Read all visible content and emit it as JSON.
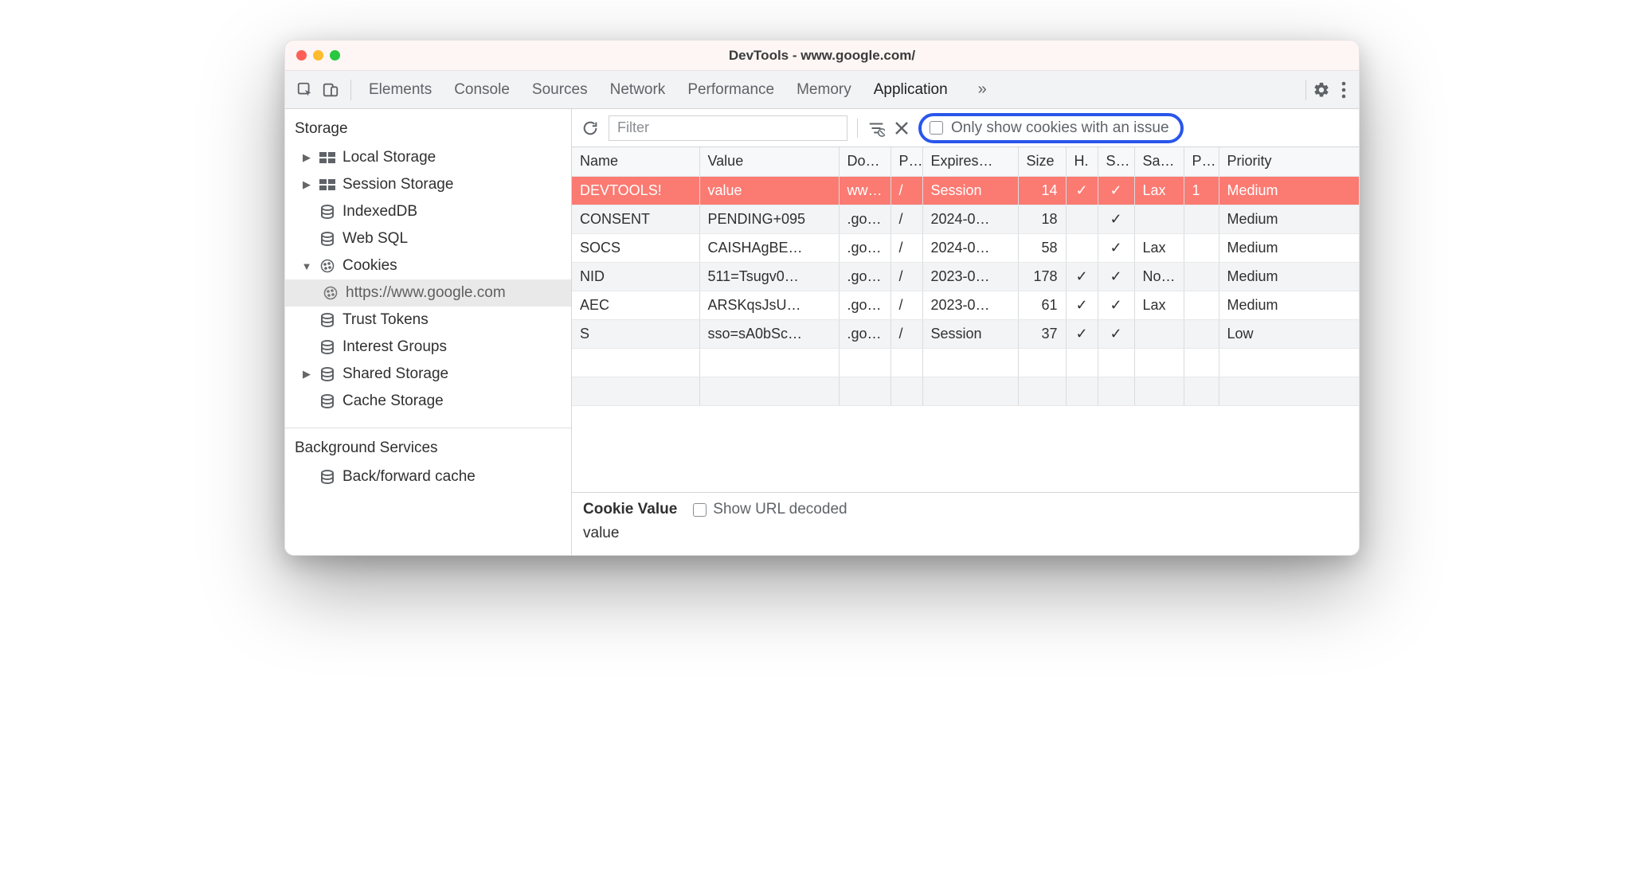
{
  "window": {
    "title": "DevTools - www.google.com/"
  },
  "tabs": {
    "items": [
      "Elements",
      "Console",
      "Sources",
      "Network",
      "Performance",
      "Memory",
      "Application"
    ],
    "active": "Application",
    "overflow": "»"
  },
  "sidebar": {
    "sections": {
      "storage": {
        "title": "Storage",
        "items": [
          {
            "label": "Local Storage",
            "icon": "grid",
            "expandable": true,
            "expanded": false
          },
          {
            "label": "Session Storage",
            "icon": "grid",
            "expandable": true,
            "expanded": false
          },
          {
            "label": "IndexedDB",
            "icon": "db",
            "expandable": false,
            "expanded": false
          },
          {
            "label": "Web SQL",
            "icon": "db",
            "expandable": false,
            "expanded": false
          },
          {
            "label": "Cookies",
            "icon": "cookie",
            "expandable": true,
            "expanded": true,
            "children": [
              {
                "label": "https://www.google.com",
                "icon": "cookie",
                "selected": true
              }
            ]
          },
          {
            "label": "Trust Tokens",
            "icon": "db",
            "expandable": false,
            "expanded": false
          },
          {
            "label": "Interest Groups",
            "icon": "db",
            "expandable": false,
            "expanded": false
          },
          {
            "label": "Shared Storage",
            "icon": "db",
            "expandable": true,
            "expanded": false
          },
          {
            "label": "Cache Storage",
            "icon": "db",
            "expandable": false,
            "expanded": false
          }
        ]
      },
      "background": {
        "title": "Background Services",
        "items": [
          {
            "label": "Back/forward cache",
            "icon": "db",
            "expandable": false,
            "expanded": false
          }
        ]
      }
    }
  },
  "toolbar": {
    "filter_placeholder": "Filter",
    "only_issues_label": "Only show cookies with an issue"
  },
  "columns": [
    "Name",
    "Value",
    "Do…",
    "P…",
    "Expires…",
    "Size",
    "H.",
    "S…",
    "Sa…",
    "P…",
    "Priority"
  ],
  "rows": [
    {
      "issue": true,
      "name": "DEVTOOLS!",
      "value": "value",
      "domain": "ww…",
      "path": "/",
      "expires": "Session",
      "size": "14",
      "http": "✓",
      "secure": "✓",
      "samesite": "Lax",
      "partition": "1",
      "priority": "Medium"
    },
    {
      "issue": false,
      "name": "CONSENT",
      "value": "PENDING+095",
      "domain": ".go…",
      "path": "/",
      "expires": "2024-0…",
      "size": "18",
      "http": "",
      "secure": "✓",
      "samesite": "",
      "partition": "",
      "priority": "Medium"
    },
    {
      "issue": false,
      "name": "SOCS",
      "value": "CAISHAgBE…",
      "domain": ".go…",
      "path": "/",
      "expires": "2024-0…",
      "size": "58",
      "http": "",
      "secure": "✓",
      "samesite": "Lax",
      "partition": "",
      "priority": "Medium"
    },
    {
      "issue": false,
      "name": "NID",
      "value": "511=Tsugv0…",
      "domain": ".go…",
      "path": "/",
      "expires": "2023-0…",
      "size": "178",
      "http": "✓",
      "secure": "✓",
      "samesite": "No…",
      "partition": "",
      "priority": "Medium"
    },
    {
      "issue": false,
      "name": "AEC",
      "value": "ARSKqsJsU…",
      "domain": ".go…",
      "path": "/",
      "expires": "2023-0…",
      "size": "61",
      "http": "✓",
      "secure": "✓",
      "samesite": "Lax",
      "partition": "",
      "priority": "Medium"
    },
    {
      "issue": false,
      "name": "S",
      "value": "sso=sA0bSc…",
      "domain": ".go…",
      "path": "/",
      "expires": "Session",
      "size": "37",
      "http": "✓",
      "secure": "✓",
      "samesite": "",
      "partition": "",
      "priority": "Low"
    }
  ],
  "detail": {
    "label": "Cookie Value",
    "show_decoded_label": "Show URL decoded",
    "value": "value"
  }
}
